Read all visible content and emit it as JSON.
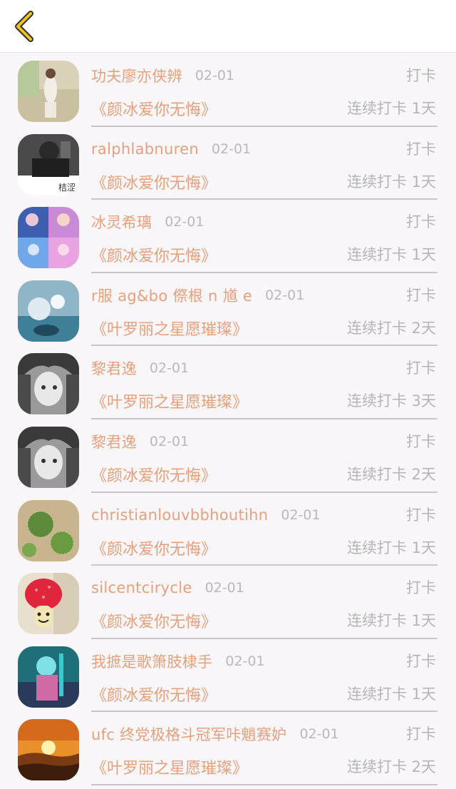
{
  "nav": {
    "back_icon": "chevron-left-icon",
    "accent": "#f2c31a"
  },
  "colors": {
    "accent_text": "#e7a07b",
    "muted_text": "#b6b6b6",
    "background": "#f8f6f8"
  },
  "entries": [
    {
      "name": "功夫廖亦侠辨",
      "date": "02-01",
      "action": "打卡",
      "book": "《颜冰爱你无悔》",
      "streak": "连续打卡 1天"
    },
    {
      "name": "ralphlabnuren",
      "date": "02-01",
      "action": "打卡",
      "book": "《颜冰爱你无悔》",
      "streak": "连续打卡 1天",
      "avatar_text": "桔涩"
    },
    {
      "name": "冰灵希璃",
      "date": "02-01",
      "action": "打卡",
      "book": "《颜冰爱你无悔》",
      "streak": "连续打卡 1天"
    },
    {
      "name": "r服 ag&bo 傺根 n 馗 e",
      "date": "02-01",
      "action": "打卡",
      "book": "《叶罗丽之星愿璀璨》",
      "streak": "连续打卡 2天"
    },
    {
      "name": "黎君逸",
      "date": "02-01",
      "action": "打卡",
      "book": "《叶罗丽之星愿璀璨》",
      "streak": "连续打卡 3天"
    },
    {
      "name": "黎君逸",
      "date": "02-01",
      "action": "打卡",
      "book": "《颜冰爱你无悔》",
      "streak": "连续打卡 2天"
    },
    {
      "name": "christianlouvbbhoutihn",
      "date": "02-01",
      "action": "打卡",
      "book": "《颜冰爱你无悔》",
      "streak": "连续打卡 1天"
    },
    {
      "name": "silcentcirycle",
      "date": "02-01",
      "action": "打卡",
      "book": "《颜冰爱你无悔》",
      "streak": "连续打卡 1天"
    },
    {
      "name": "我摭是歌箫肢棣手",
      "date": "02-01",
      "action": "打卡",
      "book": "《颜冰爱你无悔》",
      "streak": "连续打卡 1天"
    },
    {
      "name": "ufc 终党极格斗冠军咔魈赛妒",
      "date": "02-01",
      "action": "打卡",
      "book": "《叶罗丽之星愿璀璨》",
      "streak": "连续打卡 2天"
    }
  ]
}
